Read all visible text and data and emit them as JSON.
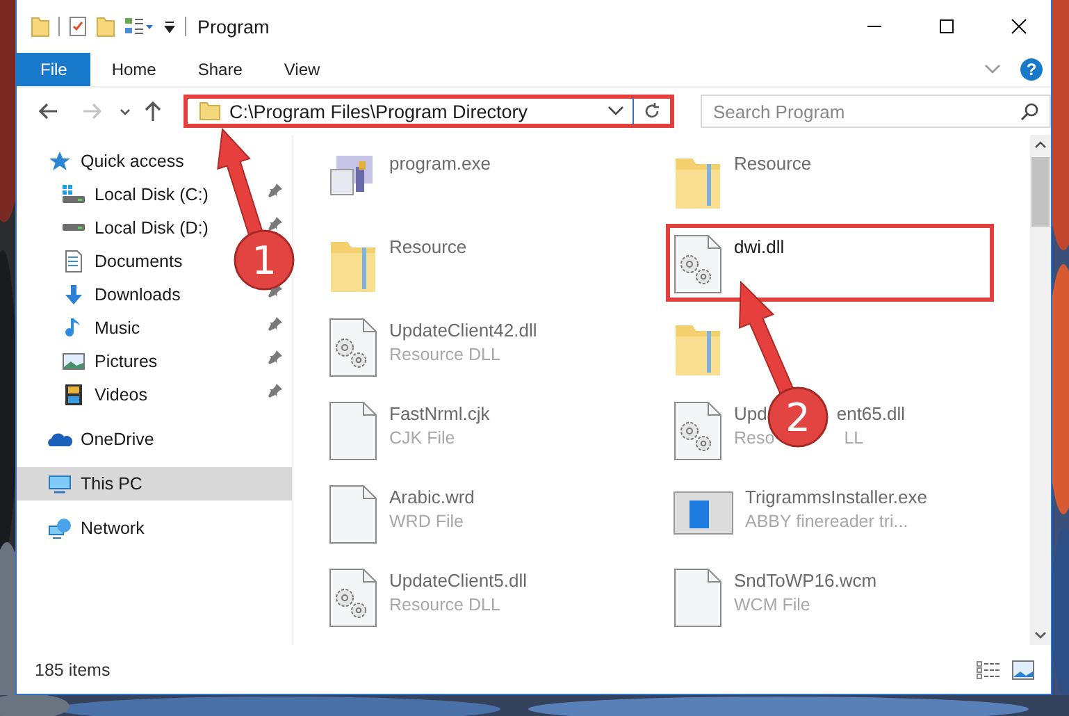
{
  "window": {
    "title": "Program"
  },
  "ribbon": {
    "tabs": [
      {
        "label": "File",
        "kind": "file"
      },
      {
        "label": "Home",
        "kind": "tab"
      },
      {
        "label": "Share",
        "kind": "tab"
      },
      {
        "label": "View",
        "kind": "tab"
      }
    ],
    "help": "?"
  },
  "nav": [
    {
      "kind": "back",
      "disabled": false
    },
    {
      "kind": "forward",
      "disabled": true
    },
    {
      "kind": "recent",
      "disabled": false
    },
    {
      "kind": "up",
      "disabled": false
    }
  ],
  "address": {
    "path": "C:\\Program Files\\Program Directory",
    "highlighted": true
  },
  "search": {
    "placeholder": "Search Program"
  },
  "sidebar": {
    "groups": [
      {
        "label": "Quick access",
        "kind": "star",
        "selected": false,
        "children": [
          {
            "label": "Local Disk (C:)",
            "kind": "drive-c",
            "pinned": true,
            "selected": false
          },
          {
            "label": "Local Disk (D:)",
            "kind": "drive",
            "pinned": true,
            "selected": false
          },
          {
            "label": "Documents",
            "kind": "documents",
            "selected": false
          },
          {
            "label": "Downloads",
            "kind": "downloads",
            "pinned": true,
            "selected": false
          },
          {
            "label": "Music",
            "kind": "music",
            "pinned": true,
            "selected": false
          },
          {
            "label": "Pictures",
            "kind": "pictures",
            "pinned": true,
            "selected": false
          },
          {
            "label": "Videos",
            "kind": "videos",
            "pinned": true,
            "selected": false
          }
        ]
      },
      {
        "label": "OneDrive",
        "kind": "cloud",
        "selected": false
      },
      {
        "label": "This PC",
        "kind": "pc",
        "selected": true
      },
      {
        "label": "Network",
        "kind": "network",
        "selected": false
      }
    ]
  },
  "files": [
    {
      "name": [
        "program.exe"
      ],
      "kind": "exe",
      "highlighted": false
    },
    {
      "name": [
        "Resource"
      ],
      "kind": "folder",
      "highlighted": false
    },
    {
      "name": [
        "Resource"
      ],
      "kind": "folder",
      "highlighted": false
    },
    {
      "name": [
        "dwi.dll"
      ],
      "kind": "dll",
      "highlighted": true
    },
    {
      "name": [
        "UpdateClient42.dll"
      ],
      "type": [
        "Resource DLL"
      ],
      "kind": "dll",
      "highlighted": false
    },
    {
      "kind": "folder",
      "highlighted": false
    },
    {
      "name": [
        "FastNrml.cjk"
      ],
      "type": [
        "CJK File"
      ],
      "kind": "file",
      "highlighted": false
    },
    {
      "name": [
        "Upd",
        "ent65.dll"
      ],
      "type": [
        "Reso",
        "LL"
      ],
      "kind": "dll",
      "highlighted": false
    },
    {
      "name": [
        "Arabic.wrd"
      ],
      "type": [
        "WRD File"
      ],
      "kind": "file",
      "highlighted": false
    },
    {
      "name": [
        "TrigrammsInstaller.exe"
      ],
      "type": [
        "ABBY finereader tri..."
      ],
      "kind": "installer",
      "highlighted": false
    },
    {
      "name": [
        "UpdateClient5.dll"
      ],
      "type": [
        "Resource DLL"
      ],
      "kind": "dll",
      "highlighted": false
    },
    {
      "name": [
        "SndToWP16.wcm"
      ],
      "type": [
        "WCM File"
      ],
      "kind": "file",
      "highlighted": false
    }
  ],
  "status_bar": {
    "count": "185 items"
  },
  "callouts": [
    {
      "number": "1"
    },
    {
      "number": "2"
    }
  ]
}
